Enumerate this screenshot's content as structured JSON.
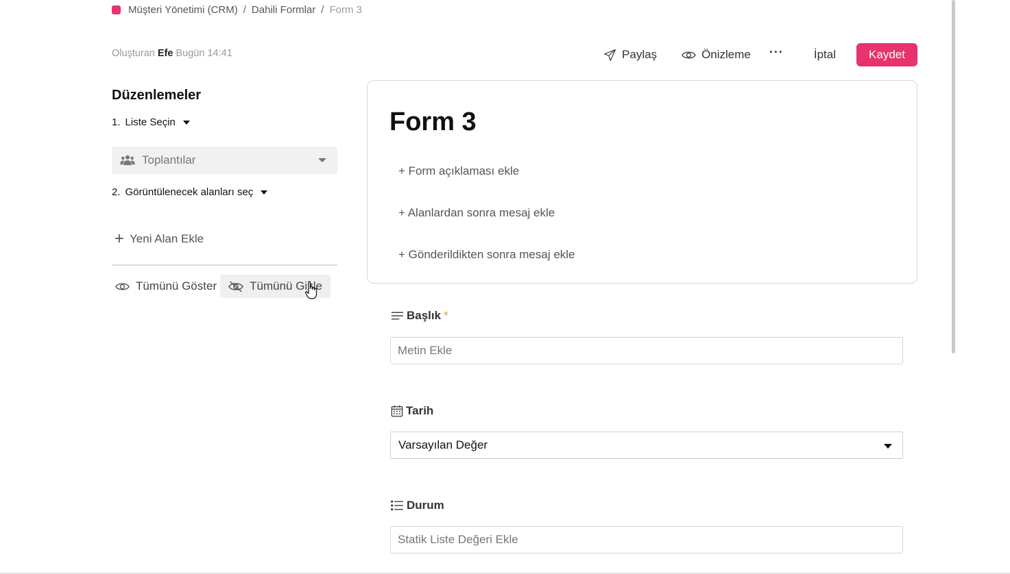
{
  "breadcrumb": {
    "items": [
      "Müşteri Yönetimi (CRM)",
      "Dahili Formlar"
    ],
    "current": "Form 3",
    "separator": "/",
    "accent_color": "#e8336d"
  },
  "meta": {
    "created_prefix": "Oluşturan",
    "author": "Efe",
    "time": "Bugün 14:41"
  },
  "toolbar": {
    "share_label": "Paylaş",
    "preview_label": "Önizleme",
    "more_label": "···",
    "cancel_label": "İptal",
    "save_label": "Kaydet",
    "save_color": "#e8336d"
  },
  "sidebar": {
    "title": "Düzenlemeler",
    "step1": {
      "number": "1.",
      "label": "Liste Seçin"
    },
    "list_select": {
      "value": "Toplantılar",
      "icon": "users-icon"
    },
    "step2": {
      "number": "2.",
      "label": "Görüntülenecek alanları seç"
    },
    "add_field_label": "Yeni Alan Ekle",
    "show_all_label": "Tümünü Göster",
    "hide_all_label": "Tümünü Gizle"
  },
  "form": {
    "title": "Form 3",
    "add_description": "+ Form açıklaması ekle",
    "add_after_fields": "+ Alanlardan sonra mesaj ekle",
    "add_after_submit": "+ Gönderildikten sonra mesaj ekle",
    "fields": [
      {
        "label": "Başlık",
        "required_mark": "*",
        "icon": "text-lines-icon",
        "placeholder": "Metin Ekle"
      },
      {
        "label": "Tarih",
        "icon": "calendar-icon",
        "value": "Varsayılan Değer"
      },
      {
        "label": "Durum",
        "icon": "list-icon",
        "placeholder": "Statik Liste Değeri Ekle"
      }
    ]
  }
}
